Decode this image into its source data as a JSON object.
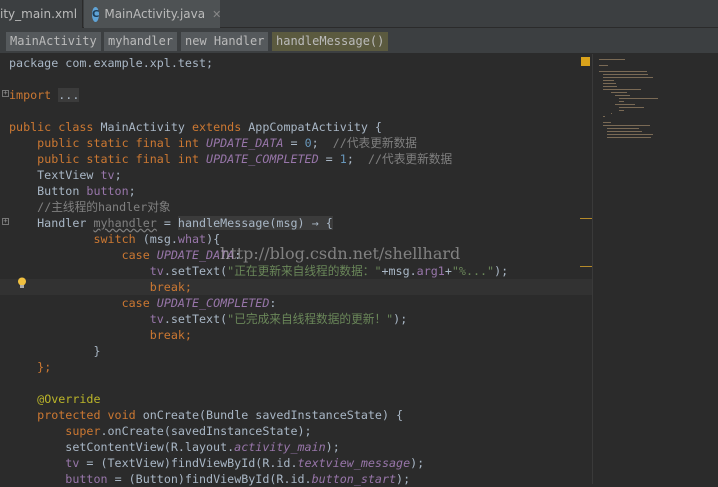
{
  "tabs": [
    {
      "label": "ity_main.xml"
    },
    {
      "label": "MainActivity.java",
      "icon": "C"
    }
  ],
  "breadcrumbs": [
    "MainActivity",
    "myhandler",
    "new Handler",
    "handleMessage()"
  ],
  "watermark": "http://blog.csdn.net/shellhard",
  "code": [
    [
      [
        "",
        "package com.example.xpl.test;"
      ]
    ],
    [],
    [
      [
        "kw",
        "import "
      ],
      [
        "fold",
        "..."
      ]
    ],
    [],
    [
      [
        "kw",
        "public class "
      ],
      [
        "",
        "MainActivity "
      ],
      [
        "kw",
        "extends "
      ],
      [
        "",
        "AppCompatActivity {"
      ]
    ],
    [
      [
        "",
        "    "
      ],
      [
        "kw",
        "public static final int "
      ],
      [
        "fd",
        "UPDATE_DATA"
      ],
      [
        "",
        " = "
      ],
      [
        "nm",
        "0"
      ],
      [
        "",
        ";  "
      ],
      [
        "cm",
        "//代表更新数据"
      ]
    ],
    [
      [
        "",
        "    "
      ],
      [
        "kw",
        "public static final int "
      ],
      [
        "fd",
        "UPDATE_COMPLETED"
      ],
      [
        "",
        " = "
      ],
      [
        "nm",
        "1"
      ],
      [
        "",
        ";  "
      ],
      [
        "cm",
        "//代表更新数据"
      ]
    ],
    [
      [
        "",
        "    TextView "
      ],
      [
        "fv",
        "tv"
      ],
      [
        "",
        ";"
      ]
    ],
    [
      [
        "",
        "    Button "
      ],
      [
        "fv",
        "button"
      ],
      [
        "",
        ";"
      ]
    ],
    [
      [
        "",
        "    "
      ],
      [
        "cm",
        "//主线程的handler对象"
      ]
    ],
    [
      [
        "",
        "    Handler "
      ],
      [
        "wv",
        "myhandler"
      ],
      [
        "",
        " = "
      ],
      [
        "fold",
        "handleMessage(msg) → {"
      ]
    ],
    [
      [
        "",
        "            "
      ],
      [
        "kw",
        "switch "
      ],
      [
        "",
        "(msg."
      ],
      [
        "fv",
        "what"
      ],
      [
        "",
        "){"
      ]
    ],
    [
      [
        "",
        "                "
      ],
      [
        "kw",
        "case "
      ],
      [
        "fd",
        "UPDATE_DATA"
      ],
      [
        "",
        ":"
      ]
    ],
    [
      [
        "",
        "                    "
      ],
      [
        "fv",
        "tv"
      ],
      [
        "",
        ".setText("
      ],
      [
        "st",
        "\"正在更新来自线程的数据：\""
      ],
      [
        "",
        "+msg."
      ],
      [
        "fv",
        "arg1"
      ],
      [
        "",
        "+"
      ],
      [
        "st",
        "\"%...\""
      ],
      [
        "",
        ");"
      ]
    ],
    [
      [
        "",
        "                    "
      ],
      [
        "kw",
        "break;"
      ]
    ],
    [
      [
        "",
        "                "
      ],
      [
        "kw",
        "case "
      ],
      [
        "fd",
        "UPDATE_COMPLETED"
      ],
      [
        "",
        ":"
      ]
    ],
    [
      [
        "",
        "                    "
      ],
      [
        "fv",
        "tv"
      ],
      [
        "",
        ".setText("
      ],
      [
        "st",
        "\"已完成来自线程数据的更新！\""
      ],
      [
        "",
        ");"
      ]
    ],
    [
      [
        "",
        "                    "
      ],
      [
        "kw",
        "break;"
      ]
    ],
    [
      [
        "",
        "            }"
      ]
    ],
    [
      [
        "",
        "    "
      ],
      [
        "kw",
        "}"
      ],
      [
        "kw",
        ";"
      ]
    ],
    [],
    [
      [
        "",
        "    "
      ],
      [
        "an",
        "@Override"
      ]
    ],
    [
      [
        "",
        "    "
      ],
      [
        "kw",
        "protected void "
      ],
      [
        "",
        "onCreate(Bundle savedInstanceState) {"
      ]
    ],
    [
      [
        "",
        "        "
      ],
      [
        "kw",
        "super"
      ],
      [
        "",
        ".onCreate(savedInstanceState);"
      ]
    ],
    [
      [
        "",
        "        setContentView(R.layout."
      ],
      [
        "mi",
        "activity_main"
      ],
      [
        "",
        ");"
      ]
    ],
    [
      [
        "",
        "        "
      ],
      [
        "fv",
        "tv"
      ],
      [
        "",
        " = (TextView)findViewById(R.id."
      ],
      [
        "mi",
        "textview_message"
      ],
      [
        "",
        ");"
      ]
    ],
    [
      [
        "",
        "        "
      ],
      [
        "fv",
        "button"
      ],
      [
        "",
        " = (Button)findViewById(R.id."
      ],
      [
        "mi",
        "button_start"
      ],
      [
        "",
        ");"
      ]
    ]
  ]
}
